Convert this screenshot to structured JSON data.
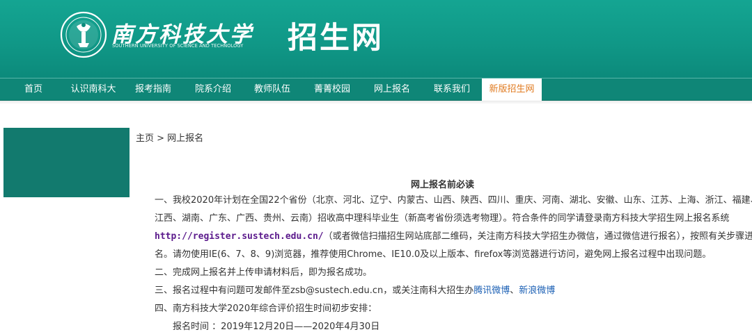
{
  "header": {
    "logo_cn": "南方科技大学",
    "logo_en": "SOUTHERN UNIVERSITY OF SCIENCE AND TECHNOLOGY",
    "site_title": "招生网"
  },
  "nav": {
    "items": [
      "首页",
      "认识南科大",
      "报考指南",
      "院系介绍",
      "教师队伍",
      "菁菁校园",
      "网上报名",
      "联系我们",
      "新版招生网"
    ],
    "active_index": 8
  },
  "breadcrumb": "主页 > 网上报名",
  "notice": {
    "title": "网上报名前必读",
    "item1_line1": "一、我校2020年计划在全国22个省份（北京、河北、辽宁、内蒙古、山西、陕西、四川、重庆、河南、湖北、安徽、山东、江苏、上海、浙江、福建、",
    "item1_line2": "江西、湖南、广东、广西、贵州、云南）招收高中理科毕业生（新高考省份须选考物理）。符合条件的同学请登录南方科技大学招生网上报名系统",
    "item1_url": "http://register.sustech.edu.cn/",
    "item1_line3_rest": "（或者微信扫描招生网站底部二维码，关注南方科技大学招生办微信，通过微信进行报名），按照有关步骤进行报",
    "item1_line4": "名。请勿使用IE(6、7、8、9)浏览器，推荐使用Chrome、IE10.0及以上版本、firefox等浏览器进行访问，避免网上报名过程中出现问题。",
    "item2": "二、完成网上报名并上传申请材料后，即为报名成功。",
    "item3_text": "三、报名过程中有问题可发邮件至zsb@sustech.edu.cn，或关注南科大招生办",
    "item3_link1": "腾讯微博",
    "item3_sep": "、",
    "item3_link2": "新浪微博",
    "item4": "四、南方科技大学2020年综合评价招生时间初步安排：",
    "item4_sub": "报名时间 ：2019年12月20日——2020年4月30日"
  },
  "colors": {
    "header_teal": "#109887",
    "nav_teal": "#0f8677",
    "active_tab_text": "#e07a1f",
    "url_purple": "#5b1a8c",
    "link_blue": "#1a5fb4",
    "side_block": "#127a6e"
  }
}
